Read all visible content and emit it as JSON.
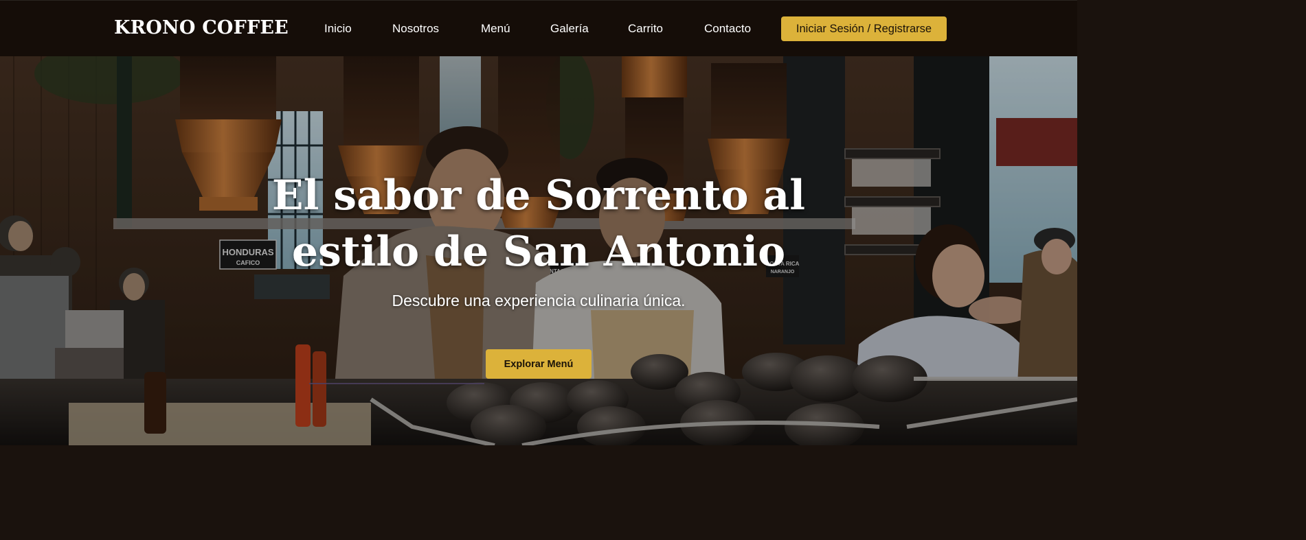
{
  "navbar": {
    "brand": "KRONO COFFEE",
    "links": [
      {
        "label": "Inicio"
      },
      {
        "label": "Nosotros"
      },
      {
        "label": "Menú"
      },
      {
        "label": "Galería"
      },
      {
        "label": "Carrito"
      },
      {
        "label": "Contacto"
      }
    ],
    "login_label": "Iniciar Sesión / Registrarse"
  },
  "hero": {
    "title_line1": "El sabor de Sorrento al",
    "title_line2": "estilo de San Antonio",
    "subtitle": "Descubre una experiencia culinaria única.",
    "cta_label": "Explorar Menú",
    "photo_signs": {
      "honduras": "HONDURAS",
      "cafico": "CAFICO",
      "vintage": "VINTAGE 2018",
      "costa_rica": "COSTA RICA",
      "naranjo": "NARANJO"
    }
  },
  "colors": {
    "nav_bg": "#150d08",
    "accent": "#dcb23a",
    "text_light": "#ffffff",
    "button_text": "#1a1208"
  },
  "icons": [
    "hero-photo-coffee-bar"
  ]
}
